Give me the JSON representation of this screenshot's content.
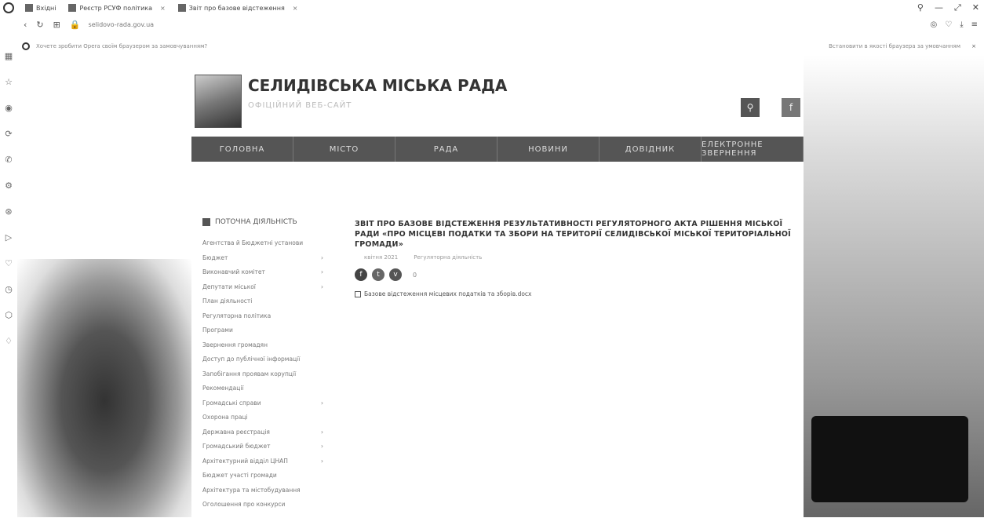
{
  "browser": {
    "tabs": [
      {
        "label": "Вхідні"
      },
      {
        "label": "Реєстр РСУФ політика"
      },
      {
        "label": "Звіт про базове відстеження"
      }
    ],
    "url": "selidovo-rada.gov.ua",
    "controls": {
      "search": "⚲",
      "minimize": "—",
      "maximize": "⤢",
      "close": "✕"
    }
  },
  "infobar": {
    "text": "Хочете зробити Opera своїм браузером за замовчуванням?",
    "right": "Встановити в якості браузера за умовчанням",
    "close": "×"
  },
  "site": {
    "title": "СЕЛИДІВСЬКА МІСЬКА РАДА",
    "subtitle": "ОФІЦІЙНИЙ ВЕБ-САЙТ",
    "search_icon": "search-icon",
    "fb_icon": "facebook-icon"
  },
  "menu": [
    "ГОЛОВНА",
    "МІСТО",
    "РАДА",
    "НОВИНИ",
    "ДОВІДНИК",
    "ЕЛЕКТРОННЕ ЗВЕРНЕННЯ"
  ],
  "leftnav": {
    "heading": "ПОТОЧНА ДІЯЛЬНІСТЬ",
    "items": [
      {
        "label": "Агентства й Бюджетні установи",
        "arrow": ""
      },
      {
        "label": "Бюджет",
        "arrow": "›"
      },
      {
        "label": "Виконавчий комітет",
        "arrow": "›"
      },
      {
        "label": "Депутати міської",
        "arrow": "›"
      },
      {
        "label": "План діяльності",
        "arrow": ""
      },
      {
        "label": "Регуляторна політика",
        "arrow": ""
      },
      {
        "label": "Програми",
        "arrow": ""
      },
      {
        "label": "Звернення громадян",
        "arrow": ""
      },
      {
        "label": "Доступ до публічної інформації",
        "arrow": ""
      },
      {
        "label": "Запобігання проявам корупції",
        "arrow": ""
      },
      {
        "label": "Рекомендації",
        "arrow": ""
      },
      {
        "label": "Громадські справи",
        "arrow": "›"
      },
      {
        "label": "Охорона праці",
        "arrow": ""
      },
      {
        "label": "Державна реєстрація",
        "arrow": "›"
      },
      {
        "label": "Громадський бюджет",
        "arrow": "›"
      },
      {
        "label": "Архітектурний відділ ЦНАП",
        "arrow": "›"
      },
      {
        "label": "Бюджет участі громади",
        "arrow": ""
      },
      {
        "label": "Архітектура та містобудування",
        "arrow": ""
      },
      {
        "label": "Оголошення про конкурси",
        "arrow": ""
      }
    ]
  },
  "article": {
    "title": "ЗВІТ ПРО БАЗОВЕ ВІДСТЕЖЕННЯ РЕЗУЛЬТАТИВНОСТІ РЕГУЛЯТОРНОГО АКТА РІШЕННЯ МІСЬКОЇ РАДИ «ПРО МІСЦЕВІ ПОДАТКИ ТА ЗБОРИ НА ТЕРИТОРІЇ СЕЛИДІВСЬКОЇ МІСЬКОЇ ТЕРИТОРІАЛЬНОЇ ГРОМАДИ»",
    "date": "квітня 2021",
    "category": "Регуляторна діяльність",
    "share_count": "0",
    "share_icons": [
      "facebook-icon",
      "twitter-icon",
      "viber-icon"
    ],
    "doc": "Базове відстеження місцевих податків та зборів.docx"
  }
}
